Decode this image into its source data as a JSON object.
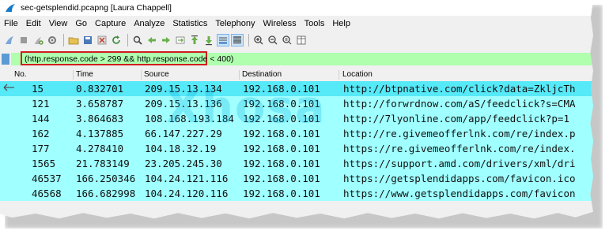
{
  "window": {
    "title": "sec-getsplendid.pcapng [Laura Chappell]"
  },
  "menu": [
    {
      "label": "File"
    },
    {
      "label": "Edit"
    },
    {
      "label": "View"
    },
    {
      "label": "Go"
    },
    {
      "label": "Capture"
    },
    {
      "label": "Analyze"
    },
    {
      "label": "Statistics"
    },
    {
      "label": "Telephony"
    },
    {
      "label": "Wireless"
    },
    {
      "label": "Tools"
    },
    {
      "label": "Help"
    }
  ],
  "filter": {
    "value": "(http.response.code > 299 && http.response.code < 400)"
  },
  "columns": [
    "No.",
    "Time",
    "Source",
    "Destination",
    "Location"
  ],
  "rows": [
    {
      "no": "15",
      "time": "0.832701",
      "src": "209.15.13.134",
      "dst": "192.168.0.101",
      "loc": "http://btpnative.com/click?data=ZkljcTh"
    },
    {
      "no": "121",
      "time": "3.658787",
      "src": "209.15.13.136",
      "dst": "192.168.0.101",
      "loc": "http://forwrdnow.com/aS/feedclick?s=CMA"
    },
    {
      "no": "144",
      "time": "3.864683",
      "src": "108.168.193.184",
      "dst": "192.168.0.101",
      "loc": "http://7lyonline.com/app/feedclick?p=1"
    },
    {
      "no": "162",
      "time": "4.137885",
      "src": "66.147.227.29",
      "dst": "192.168.0.101",
      "loc": "http://re.givemeofferlnk.com/re/index.p"
    },
    {
      "no": "177",
      "time": "4.278410",
      "src": "104.18.32.19",
      "dst": "192.168.0.101",
      "loc": "https://re.givemeofferlnk.com/re/index."
    },
    {
      "no": "1565",
      "time": "21.783149",
      "src": "23.205.245.30",
      "dst": "192.168.0.101",
      "loc": "https://support.amd.com/drivers/xml/dri"
    },
    {
      "no": "46537",
      "time": "166.250346",
      "src": "104.24.121.116",
      "dst": "192.168.0.101",
      "loc": "https://getsplendidapps.com/favicon.ico"
    },
    {
      "no": "46568",
      "time": "166.682998",
      "src": "104.24.120.116",
      "dst": "192.168.0.101",
      "loc": "https://www.getsplendidapps.com/favicon"
    }
  ],
  "watermark": "Xhosa",
  "colors": {
    "filter_bg": "#afffaf",
    "highlight_box": "#d21e1e",
    "row_bg": "#a0ffff",
    "selected_row_bg": "#56e9f8"
  }
}
